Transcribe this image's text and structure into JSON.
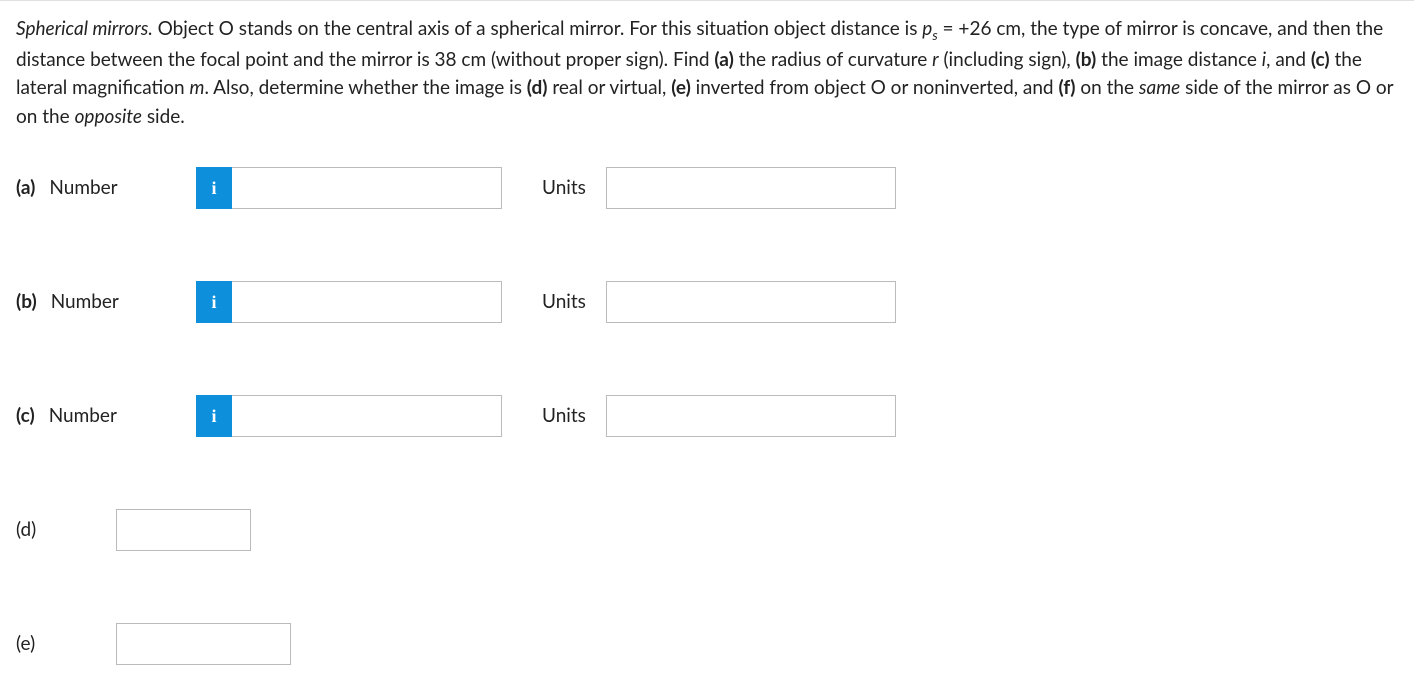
{
  "question": {
    "intro_italic": "Spherical mirrors.",
    "text_1": " Object O stands on the central axis of a spherical mirror. For this situation object distance is ",
    "var_ps": "p",
    "var_ps_sub": "s",
    "text_2": " = +26 cm, the type of mirror is concave, and then the distance between the focal point and the mirror is 38 cm (without proper sign). Find ",
    "part_a_bold": "(a)",
    "text_3": " the radius of curvature ",
    "var_r": "r",
    "text_4": " (including sign), ",
    "part_b_bold": "(b)",
    "text_5": " the image distance ",
    "var_i": "i",
    "text_6": ", and ",
    "part_c_bold": "(c)",
    "text_7": " the lateral magnification ",
    "var_m": "m",
    "text_8": ". Also, determine whether the image is ",
    "part_d_bold": "(d)",
    "text_9": " real or virtual, ",
    "part_e_bold": "(e)",
    "text_10": " inverted from object O or noninverted, and ",
    "part_f_bold": "(f)",
    "text_11": " on the ",
    "same_italic": "same",
    "text_12": " side of the mirror as O or on the ",
    "opposite_italic": "opposite",
    "text_13": " side."
  },
  "parts": {
    "a": {
      "letter": "(a)",
      "label": "Number",
      "info": "i",
      "value": "",
      "units_label": "Units",
      "units_value": ""
    },
    "b": {
      "letter": "(b)",
      "label": "Number",
      "info": "i",
      "value": "",
      "units_label": "Units",
      "units_value": ""
    },
    "c": {
      "letter": "(c)",
      "label": "Number",
      "info": "i",
      "value": "",
      "units_label": "Units",
      "units_value": ""
    },
    "d": {
      "letter": "(d)",
      "value": ""
    },
    "e": {
      "letter": "(e)",
      "value": ""
    }
  }
}
